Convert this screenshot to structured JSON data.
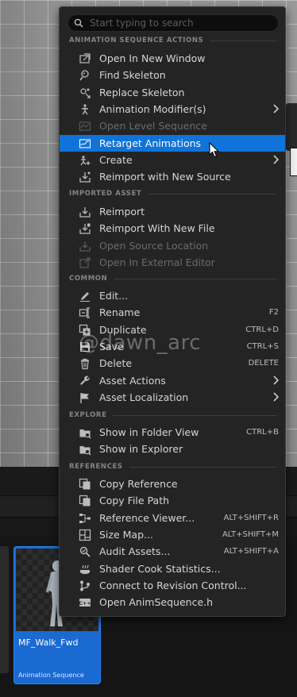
{
  "search": {
    "placeholder": "Start typing to search"
  },
  "sections": {
    "animation_sequence_actions": "ANIMATION SEQUENCE ACTIONS",
    "imported_asset": "IMPORTED ASSET",
    "common": "COMMON",
    "explore": "EXPLORE",
    "references": "REFERENCES"
  },
  "anim_actions": [
    {
      "label": "Open In New Window",
      "icon": "new-window-icon"
    },
    {
      "label": "Find Skeleton",
      "icon": "find-skeleton-icon"
    },
    {
      "label": "Replace Skeleton",
      "icon": "replace-skeleton-icon"
    },
    {
      "label": "Animation Modifier(s)",
      "icon": "modifier-icon",
      "submenu": true
    },
    {
      "label": "Open Level Sequence",
      "icon": "level-sequence-icon",
      "disabled": true
    },
    {
      "label": "Retarget Animations",
      "icon": "retarget-icon",
      "highlighted": true
    },
    {
      "label": "Create",
      "icon": "create-icon",
      "submenu": true
    },
    {
      "label": "Reimport with New Source",
      "icon": "reimport-source-icon"
    }
  ],
  "imported": [
    {
      "label": "Reimport",
      "icon": "reimport-icon"
    },
    {
      "label": "Reimport With New File",
      "icon": "reimport-file-icon"
    },
    {
      "label": "Open Source Location",
      "icon": "source-location-icon",
      "disabled": true
    },
    {
      "label": "Open In External Editor",
      "icon": "external-editor-icon",
      "disabled": true
    }
  ],
  "common": [
    {
      "label": "Edit...",
      "icon": "edit-icon"
    },
    {
      "label": "Rename",
      "icon": "rename-icon",
      "shortcut": "F2"
    },
    {
      "label": "Duplicate",
      "icon": "duplicate-icon",
      "shortcut": "CTRL+D"
    },
    {
      "label": "Save",
      "icon": "save-icon",
      "shortcut": "CTRL+S"
    },
    {
      "label": "Delete",
      "icon": "delete-icon",
      "shortcut": "DELETE"
    },
    {
      "label": "Asset Actions",
      "icon": "wrench-icon",
      "submenu": true
    },
    {
      "label": "Asset Localization",
      "icon": "flag-icon",
      "submenu": true
    }
  ],
  "explore": [
    {
      "label": "Show in Folder View",
      "icon": "folder-view-icon",
      "shortcut": "CTRL+B"
    },
    {
      "label": "Show in Explorer",
      "icon": "explorer-icon"
    }
  ],
  "references": [
    {
      "label": "Copy Reference",
      "icon": "copy-reference-icon"
    },
    {
      "label": "Copy File Path",
      "icon": "copy-path-icon"
    },
    {
      "label": "Reference Viewer...",
      "icon": "reference-viewer-icon",
      "shortcut": "ALT+SHIFT+R"
    },
    {
      "label": "Size Map...",
      "icon": "size-map-icon",
      "shortcut": "ALT+SHIFT+M"
    },
    {
      "label": "Audit Assets...",
      "icon": "audit-icon",
      "shortcut": "ALT+SHIFT+A"
    },
    {
      "label": "Shader Cook Statistics...",
      "icon": "shader-icon"
    },
    {
      "label": "Connect to Revision Control...",
      "icon": "revision-control-icon"
    },
    {
      "label": "Open AnimSequence.h",
      "icon": "cpp-header-icon"
    }
  ],
  "watermark": "@dawn_arc",
  "asset": {
    "name": "MF_Walk_Fwd",
    "type": "Animation Sequence"
  },
  "colors": {
    "highlight": "#0f73d9",
    "menu_bg": "#242424",
    "asset_card": "#1a6ad1"
  }
}
